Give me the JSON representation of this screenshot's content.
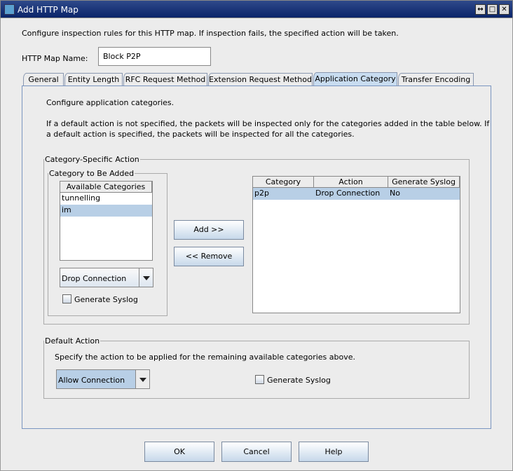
{
  "window": {
    "title": "Add HTTP Map",
    "controls": [
      "restore",
      "maximize",
      "close"
    ]
  },
  "intro": "Configure inspection rules for this HTTP map. If inspection fails, the specified action will be taken.",
  "map_name": {
    "label": "HTTP Map Name:",
    "value": "Block P2P"
  },
  "tabs": [
    {
      "label": "General"
    },
    {
      "label": "Entity Length"
    },
    {
      "label": "RFC Request Method"
    },
    {
      "label": "Extension Request Method"
    },
    {
      "label": "Application Category",
      "active": true
    },
    {
      "label": "Transfer Encoding"
    }
  ],
  "panel": {
    "intro": "Configure application categories.",
    "note1": "If a default action is not specified, the packets will be inspected only for the categories added in the table below. If",
    "note2": "a default action is specified, the packets will be inspected for all the categories.",
    "category_specific": {
      "legend": "Category-Specific Action",
      "to_add": {
        "legend": "Category to Be Added",
        "list_header": "Available Categories",
        "items": [
          {
            "label": "tunnelling"
          },
          {
            "label": "im",
            "selected": true
          }
        ],
        "action": "Drop Connection",
        "syslog_label": "Generate Syslog",
        "syslog_checked": false
      },
      "add_label": "Add >>",
      "remove_label": "<< Remove",
      "table": {
        "columns": [
          "Category",
          "Action",
          "Generate Syslog"
        ],
        "rows": [
          [
            "p2p",
            "Drop Connection",
            "No"
          ]
        ]
      }
    },
    "default_action": {
      "legend": "Default Action",
      "text": "Specify the action to be applied for the remaining available categories above.",
      "action": "Allow Connection",
      "syslog_label": "Generate Syslog",
      "syslog_checked": false
    }
  },
  "buttons": {
    "ok": "OK",
    "cancel": "Cancel",
    "help": "Help"
  }
}
